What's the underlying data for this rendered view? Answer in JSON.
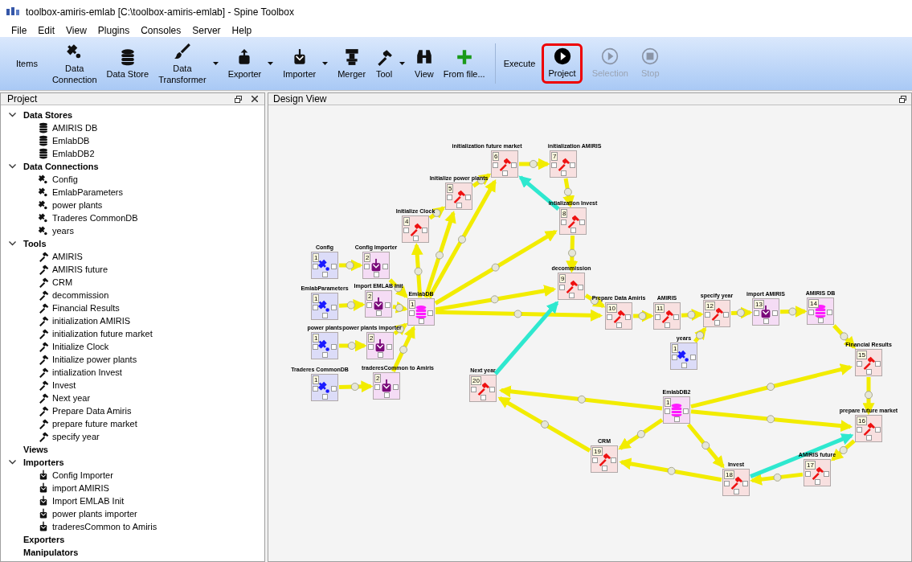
{
  "window": {
    "title": "toolbox-amiris-emlab [C:\\toolbox-amiris-emlab] - Spine Toolbox"
  },
  "menu": [
    "File",
    "Edit",
    "View",
    "Plugins",
    "Consoles",
    "Server",
    "Help"
  ],
  "toolbar": {
    "items_label": "Items",
    "items": [
      {
        "label": "Data\nConnection",
        "kind": "connection",
        "dropdown": false
      },
      {
        "label": "Data Store",
        "kind": "store",
        "dropdown": false
      },
      {
        "label": "Data\nTransformer",
        "kind": "transformer",
        "dropdown": true
      },
      {
        "label": "Exporter",
        "kind": "exporter",
        "dropdown": true
      },
      {
        "label": "Importer",
        "kind": "importer",
        "dropdown": true
      },
      {
        "label": "Merger",
        "kind": "merger",
        "dropdown": false
      },
      {
        "label": "Tool",
        "kind": "tool",
        "dropdown": true
      },
      {
        "label": "View",
        "kind": "view",
        "dropdown": false
      },
      {
        "label": "From file...",
        "kind": "add",
        "dropdown": false
      }
    ],
    "execute_label": "Execute",
    "execute": [
      {
        "label": "Project",
        "kind": "play",
        "disabled": false,
        "highlighted": true
      },
      {
        "label": "Selection",
        "kind": "play",
        "disabled": true,
        "highlighted": false
      },
      {
        "label": "Stop",
        "kind": "stop",
        "disabled": true,
        "highlighted": false
      }
    ]
  },
  "project_panel": {
    "title": "Project",
    "tree": [
      {
        "label": "Data Stores",
        "children": [
          {
            "label": "AMIRIS DB",
            "kind": "store"
          },
          {
            "label": "EmlabDB",
            "kind": "store"
          },
          {
            "label": "EmlabDB2",
            "kind": "store"
          }
        ]
      },
      {
        "label": "Data Connections",
        "children": [
          {
            "label": "Config",
            "kind": "connection"
          },
          {
            "label": "EmlabParameters",
            "kind": "connection"
          },
          {
            "label": "power plants",
            "kind": "connection"
          },
          {
            "label": "Traderes CommonDB",
            "kind": "connection"
          },
          {
            "label": "years",
            "kind": "connection"
          }
        ]
      },
      {
        "label": "Tools",
        "children": [
          {
            "label": "AMIRIS",
            "kind": "tool"
          },
          {
            "label": "AMIRIS future",
            "kind": "tool"
          },
          {
            "label": "CRM",
            "kind": "tool"
          },
          {
            "label": "decommission",
            "kind": "tool"
          },
          {
            "label": "Financial Results",
            "kind": "tool"
          },
          {
            "label": "initialization AMIRIS",
            "kind": "tool"
          },
          {
            "label": "initialization future market",
            "kind": "tool"
          },
          {
            "label": "Initialize Clock",
            "kind": "tool"
          },
          {
            "label": "Initialize power plants",
            "kind": "tool"
          },
          {
            "label": "intialization Invest",
            "kind": "tool"
          },
          {
            "label": "Invest",
            "kind": "tool"
          },
          {
            "label": "Next year",
            "kind": "tool"
          },
          {
            "label": "Prepare Data Amiris",
            "kind": "tool"
          },
          {
            "label": "prepare future market",
            "kind": "tool"
          },
          {
            "label": "specify year",
            "kind": "tool"
          }
        ]
      },
      {
        "label": "Views"
      },
      {
        "label": "Importers",
        "children": [
          {
            "label": "Config Importer",
            "kind": "importer"
          },
          {
            "label": "import AMIRIS",
            "kind": "importer"
          },
          {
            "label": "Import EMLAB Init",
            "kind": "importer"
          },
          {
            "label": "power plants importer",
            "kind": "importer"
          },
          {
            "label": "traderesCommon to Amiris",
            "kind": "importer"
          }
        ]
      },
      {
        "label": "Exporters"
      },
      {
        "label": "Manipulators"
      }
    ]
  },
  "design_view": {
    "title": "Design View",
    "nodes": [
      {
        "label": "initialization future market",
        "number": "6",
        "kind": "tool"
      },
      {
        "label": "initialization AMIRIS",
        "number": "7",
        "kind": "tool"
      },
      {
        "label": "Initialize power plants",
        "number": "5",
        "kind": "tool"
      },
      {
        "label": "intialization Invest",
        "number": "8",
        "kind": "tool"
      },
      {
        "label": "Initialize Clock",
        "number": "4",
        "kind": "tool"
      },
      {
        "label": "Config",
        "number": "1",
        "kind": "connection"
      },
      {
        "label": "Config Importer",
        "number": "2",
        "kind": "importer"
      },
      {
        "label": "decommission",
        "number": "9",
        "kind": "tool"
      },
      {
        "label": "EmlabParameters",
        "number": "1",
        "kind": "connection"
      },
      {
        "label": "Import EMLAB Init",
        "number": "2",
        "kind": "importer"
      },
      {
        "label": "EmlabDB",
        "number": "1",
        "kind": "store"
      },
      {
        "label": "Prepare Data Amiris",
        "number": "10",
        "kind": "tool"
      },
      {
        "label": "AMIRIS",
        "number": "11",
        "kind": "tool"
      },
      {
        "label": "specify year",
        "number": "12",
        "kind": "tool"
      },
      {
        "label": "import AMIRIS",
        "number": "13",
        "kind": "importer"
      },
      {
        "label": "AMIRIS DB",
        "number": "14",
        "kind": "store"
      },
      {
        "label": "power plants",
        "number": "1",
        "kind": "connection"
      },
      {
        "label": "power plants importer",
        "number": "2",
        "kind": "importer"
      },
      {
        "label": "years",
        "number": "1",
        "kind": "connection"
      },
      {
        "label": "Financial Results",
        "number": "15",
        "kind": "tool"
      },
      {
        "label": "Traderes CommonDB",
        "number": "1",
        "kind": "connection"
      },
      {
        "label": "traderesCommon to Amiris",
        "number": "2",
        "kind": "importer"
      },
      {
        "label": "Next year",
        "number": "20",
        "kind": "tool"
      },
      {
        "label": "EmlabDB2",
        "number": "1",
        "kind": "store"
      },
      {
        "label": "prepare future market",
        "number": "16",
        "kind": "tool"
      },
      {
        "label": "CRM",
        "number": "19",
        "kind": "tool"
      },
      {
        "label": "AMIRIS future",
        "number": "17",
        "kind": "tool"
      },
      {
        "label": "Invest",
        "number": "18",
        "kind": "tool"
      }
    ]
  }
}
